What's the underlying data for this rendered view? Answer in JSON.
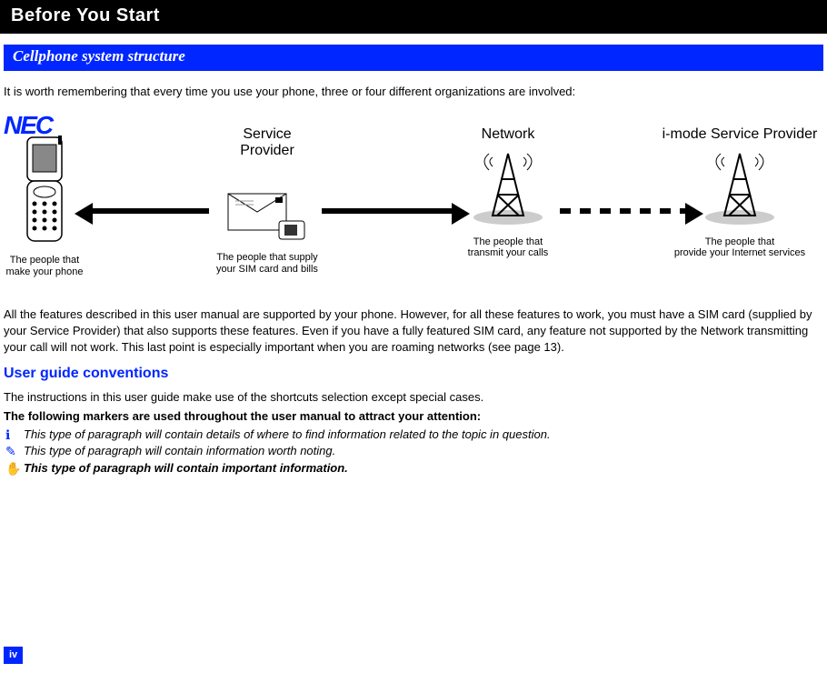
{
  "header": "Before You Start",
  "section_title": "Cellphone system structure",
  "intro": "It is worth remembering that every time you use your phone, three or four different organizations are involved:",
  "diagram": {
    "logo": "NEC",
    "phone_caption": "The people that\nmake your phone",
    "service_label": "Service\nProvider",
    "service_caption": "The people that supply\nyour SIM card and bills",
    "network_label": "Network",
    "network_caption": "The people that\ntransmit your calls",
    "imode_label": "i-mode Service Provider",
    "imode_caption": "The people that\nprovide your Internet services"
  },
  "para_after_diagram": "All the features described in this user manual are supported by your phone. However, for all these features to work, you must have a SIM card (supplied by your Service Provider) that also supports these features. Even if you have a fully featured SIM card, any feature not supported by the Network transmitting your call will not work. This last point is especially important when you are roaming networks (see page 13).",
  "h2": "User guide conventions",
  "conv_intro": "The instructions in this user guide make use of the shortcuts selection except special cases.",
  "markers_intro": "The following markers are used throughout the user manual to attract your attention:",
  "markers": [
    {
      "sym": "ℹ",
      "text": "This type of paragraph will contain details of where to find information related to the topic in question.",
      "bold": false
    },
    {
      "sym": "✎",
      "text": "This type of paragraph will contain information worth noting.",
      "bold": false
    },
    {
      "sym": "✋",
      "text": "This type of paragraph will contain important information.",
      "bold": true
    }
  ],
  "page_number": "iv"
}
